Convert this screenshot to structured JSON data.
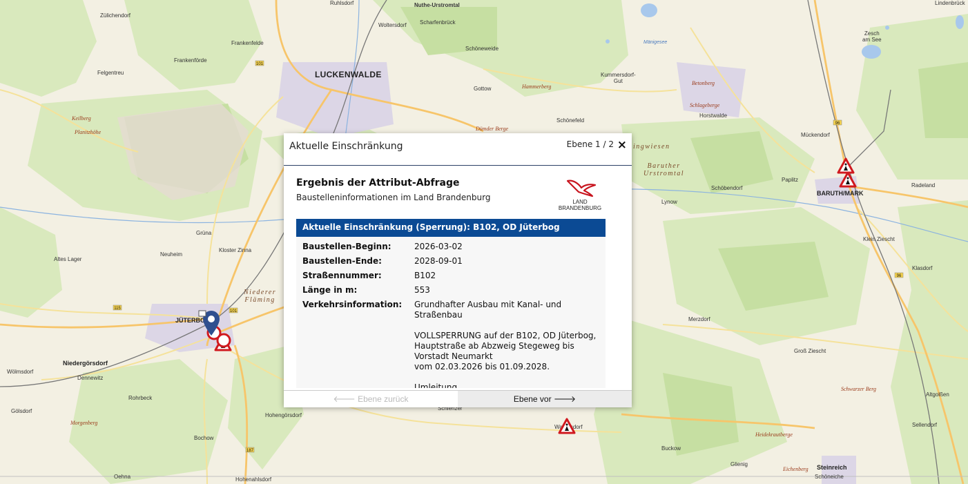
{
  "map": {
    "places": [
      {
        "id": "zuelichendorf",
        "text": "Zülichendorf",
        "cls": ""
      },
      {
        "id": "ruhlsdorf",
        "text": "Ruhlsdorf",
        "cls": ""
      },
      {
        "id": "nuthe-urstromtal",
        "text": "Nuthe-Urstromtal",
        "cls": "ul"
      },
      {
        "id": "woltersdorf",
        "text": "Woltersdorf",
        "cls": ""
      },
      {
        "id": "scharfenbrueck",
        "text": "Scharfenbrück",
        "cls": ""
      },
      {
        "id": "frankenfelde",
        "text": "Frankenfelde",
        "cls": ""
      },
      {
        "id": "schoeneweide",
        "text": "Schöneweide",
        "cls": ""
      },
      {
        "id": "frankenfoerde",
        "text": "Frankenförde",
        "cls": ""
      },
      {
        "id": "felgentreu",
        "text": "Felgentreu",
        "cls": ""
      },
      {
        "id": "luckenwalde",
        "text": "LUCKENWALDE",
        "cls": "big"
      },
      {
        "id": "kummersdorf-gut",
        "text": "Kummersdorf-\nGut",
        "cls": ""
      },
      {
        "id": "hammerberg",
        "text": "Hammerberg",
        "cls": "feat"
      },
      {
        "id": "gottow",
        "text": "Gottow",
        "cls": ""
      },
      {
        "id": "betonberg",
        "text": "Betonberg",
        "cls": "feat"
      },
      {
        "id": "keilberg",
        "text": "Keilberg",
        "cls": "feat"
      },
      {
        "id": "planitzhoehe",
        "text": "Planitzhöhe",
        "cls": "feat"
      },
      {
        "id": "schlageberge",
        "text": "Schlageberge",
        "cls": "feat"
      },
      {
        "id": "horstwalde",
        "text": "Horstwalde",
        "cls": ""
      },
      {
        "id": "schoenefeld",
        "text": "Schönefeld",
        "cls": ""
      },
      {
        "id": "duemder-berge",
        "text": "Dümder Berge",
        "cls": "feat"
      },
      {
        "id": "mueckendorf",
        "text": "Mückendorf",
        "cls": ""
      },
      {
        "id": "lindenbrueck",
        "text": "Lindenbrück",
        "cls": ""
      },
      {
        "id": "zesch-am-see",
        "text": "Zesch\nam See",
        "cls": ""
      },
      {
        "id": "wiesen",
        "text": "ingwiesen",
        "cls": "region"
      },
      {
        "id": "baruther-urstromtal",
        "text": "Baruther\nUrstromtal",
        "cls": "region"
      },
      {
        "id": "schoebendorf",
        "text": "Schöbendorf",
        "cls": ""
      },
      {
        "id": "paplitz",
        "text": "Paplitz",
        "cls": ""
      },
      {
        "id": "baruth-mark",
        "text": "BARUTH/MARK",
        "cls": "mid"
      },
      {
        "id": "radeland",
        "text": "Radeland",
        "cls": ""
      },
      {
        "id": "lynow",
        "text": "Lynow",
        "cls": ""
      },
      {
        "id": "gruena",
        "text": "Grüna",
        "cls": ""
      },
      {
        "id": "kloster-zinna",
        "text": "Kloster Zinna",
        "cls": ""
      },
      {
        "id": "klein-ziescht",
        "text": "Klein Ziescht",
        "cls": ""
      },
      {
        "id": "altes-lager",
        "text": "Altes Lager",
        "cls": ""
      },
      {
        "id": "neuheim",
        "text": "Neuheim",
        "cls": ""
      },
      {
        "id": "klasdorf",
        "text": "Klasdorf",
        "cls": ""
      },
      {
        "id": "niederer-flaeming",
        "text": "Niederer\nFläming",
        "cls": "region"
      },
      {
        "id": "jueterbog",
        "text": "JÜTERBOG",
        "cls": "mid"
      },
      {
        "id": "merzdorf",
        "text": "Merzdorf",
        "cls": ""
      },
      {
        "id": "niedergoersdorf",
        "text": "Niedergörsdorf",
        "cls": "mid"
      },
      {
        "id": "woelmsdorf",
        "text": "Wölmsdorf",
        "cls": ""
      },
      {
        "id": "dennewitz",
        "text": "Dennewitz",
        "cls": ""
      },
      {
        "id": "gross-ziescht",
        "text": "Groß Ziescht",
        "cls": ""
      },
      {
        "id": "rohrbeck",
        "text": "Rohrbeck",
        "cls": ""
      },
      {
        "id": "schwarzer-berg",
        "text": "Schwarzer Berg",
        "cls": "feat"
      },
      {
        "id": "goelsdorf",
        "text": "Gölsdorf",
        "cls": ""
      },
      {
        "id": "hohengoersdorf",
        "text": "Hohengörsdorf",
        "cls": ""
      },
      {
        "id": "schlenzer",
        "text": "Schlenzer",
        "cls": ""
      },
      {
        "id": "altgolssen",
        "text": "Altgolßen",
        "cls": ""
      },
      {
        "id": "morgenberg",
        "text": "Morgenberg",
        "cls": "feat"
      },
      {
        "id": "sellendorf",
        "text": "Sellendorf",
        "cls": ""
      },
      {
        "id": "bochow",
        "text": "Bochow",
        "cls": ""
      },
      {
        "id": "waltersdorf",
        "text": "Waltersdorf",
        "cls": ""
      },
      {
        "id": "heidekrautberge",
        "text": "Heidekrautberge",
        "cls": "feat"
      },
      {
        "id": "buckow",
        "text": "Buckow",
        "cls": ""
      },
      {
        "id": "glienig",
        "text": "Glienig",
        "cls": ""
      },
      {
        "id": "eichenberg",
        "text": "Eichenberg",
        "cls": "feat"
      },
      {
        "id": "steinreich",
        "text": "Steinreich",
        "cls": "mid"
      },
      {
        "id": "oehna",
        "text": "Oehna",
        "cls": ""
      },
      {
        "id": "hohenahlsdorf",
        "text": "Hohenahlsdorf",
        "cls": ""
      },
      {
        "id": "schoeneiche",
        "text": "Schöneiche",
        "cls": ""
      },
      {
        "id": "maenige-see",
        "text": "Mänigesee",
        "cls": "water"
      }
    ]
  },
  "popup": {
    "title": "Aktuelle Einschränkung",
    "layer": "Ebene 1 / 2",
    "close": "×",
    "result_title": "Ergebnis der Attribut-Abfrage",
    "result_subtitle": "Baustelleninformationen im Land Brandenburg",
    "logo_line1": "LAND",
    "logo_line2": "BRANDENBURG",
    "bar": "Aktuelle Einschränkung (Sperrung): B102, OD Jüterbog",
    "rows": [
      {
        "key": "Baustellen-Beginn:",
        "value": "2026-03-02"
      },
      {
        "key": "Baustellen-Ende:",
        "value": "2028-09-01"
      },
      {
        "key": "Straßennummer:",
        "value": "B102"
      },
      {
        "key": "Länge in m:",
        "value": "553"
      },
      {
        "key": "Verkehrsinformation:",
        "value": "Grundhafter Ausbau mit Kanal- und Straßenbau\n\nVOLLSPERRUNG auf der B102, OD Jüterbog, Hauptstraße ab Abzweig Stegeweg bis Vorstadt Neumarkt\nvom 02.03.2026 bis 01.09.2028.\n\nUmleitung"
      }
    ],
    "prev_label": "Ebene zurück",
    "next_label": "Ebene vor"
  }
}
